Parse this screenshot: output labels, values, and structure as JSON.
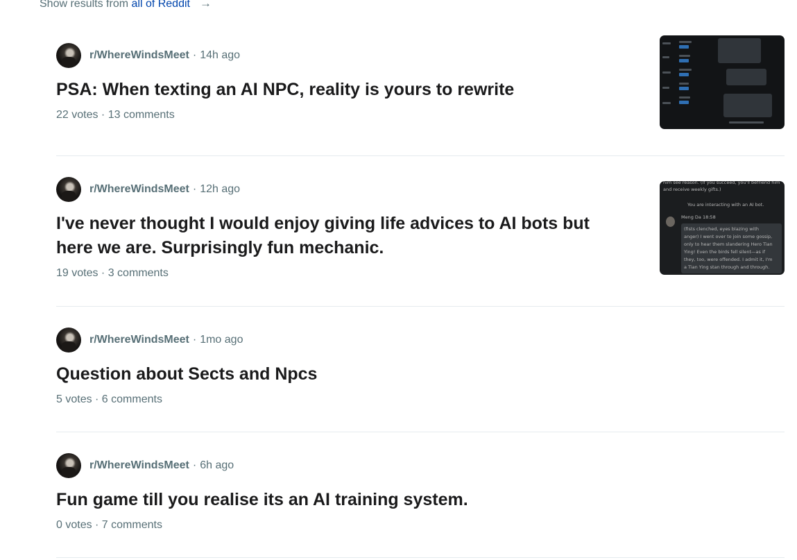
{
  "header": {
    "show_results_prefix": "Show results from ",
    "show_results_link": "all of Reddit",
    "arrow_icon": "arrow-right-icon"
  },
  "posts": [
    {
      "subreddit": "r/WhereWindsMeet",
      "separator": "·",
      "time": "14h ago",
      "title": "PSA: When texting an AI NPC, reality is yours to rewrite",
      "stats": "22 votes · 13 comments",
      "has_thumbnail": true
    },
    {
      "subreddit": "r/WhereWindsMeet",
      "separator": "·",
      "time": "12h ago",
      "title": "I've never thought I would enjoy giving life advices to AI bots but here we are. Surprisingly fun mechanic.",
      "stats": "19 votes · 3 comments",
      "has_thumbnail": true,
      "thumbnail_text": [
        "him see reason. (If you succeed, you'll befriend him",
        "and receive weekly gifts.)",
        "You are interacting with an AI bot.",
        "Meng Da  18:58",
        "(fists clenched, eyes blazing with",
        "anger) I went over to join some gossip,",
        "only to hear them slandering Hero Tian",
        "Ying! Even the birds fell silent—as if",
        "they, too, were offended. I admit it, I'm",
        "a Tian Ying stan through and through."
      ]
    },
    {
      "subreddit": "r/WhereWindsMeet",
      "separator": "·",
      "time": "1mo ago",
      "title": "Question about Sects and Npcs",
      "stats": "5 votes · 6 comments",
      "has_thumbnail": false
    },
    {
      "subreddit": "r/WhereWindsMeet",
      "separator": "·",
      "time": "6h ago",
      "title": "Fun game till you realise its an AI training system.",
      "stats": "0 votes · 7 comments",
      "has_thumbnail": false
    }
  ]
}
